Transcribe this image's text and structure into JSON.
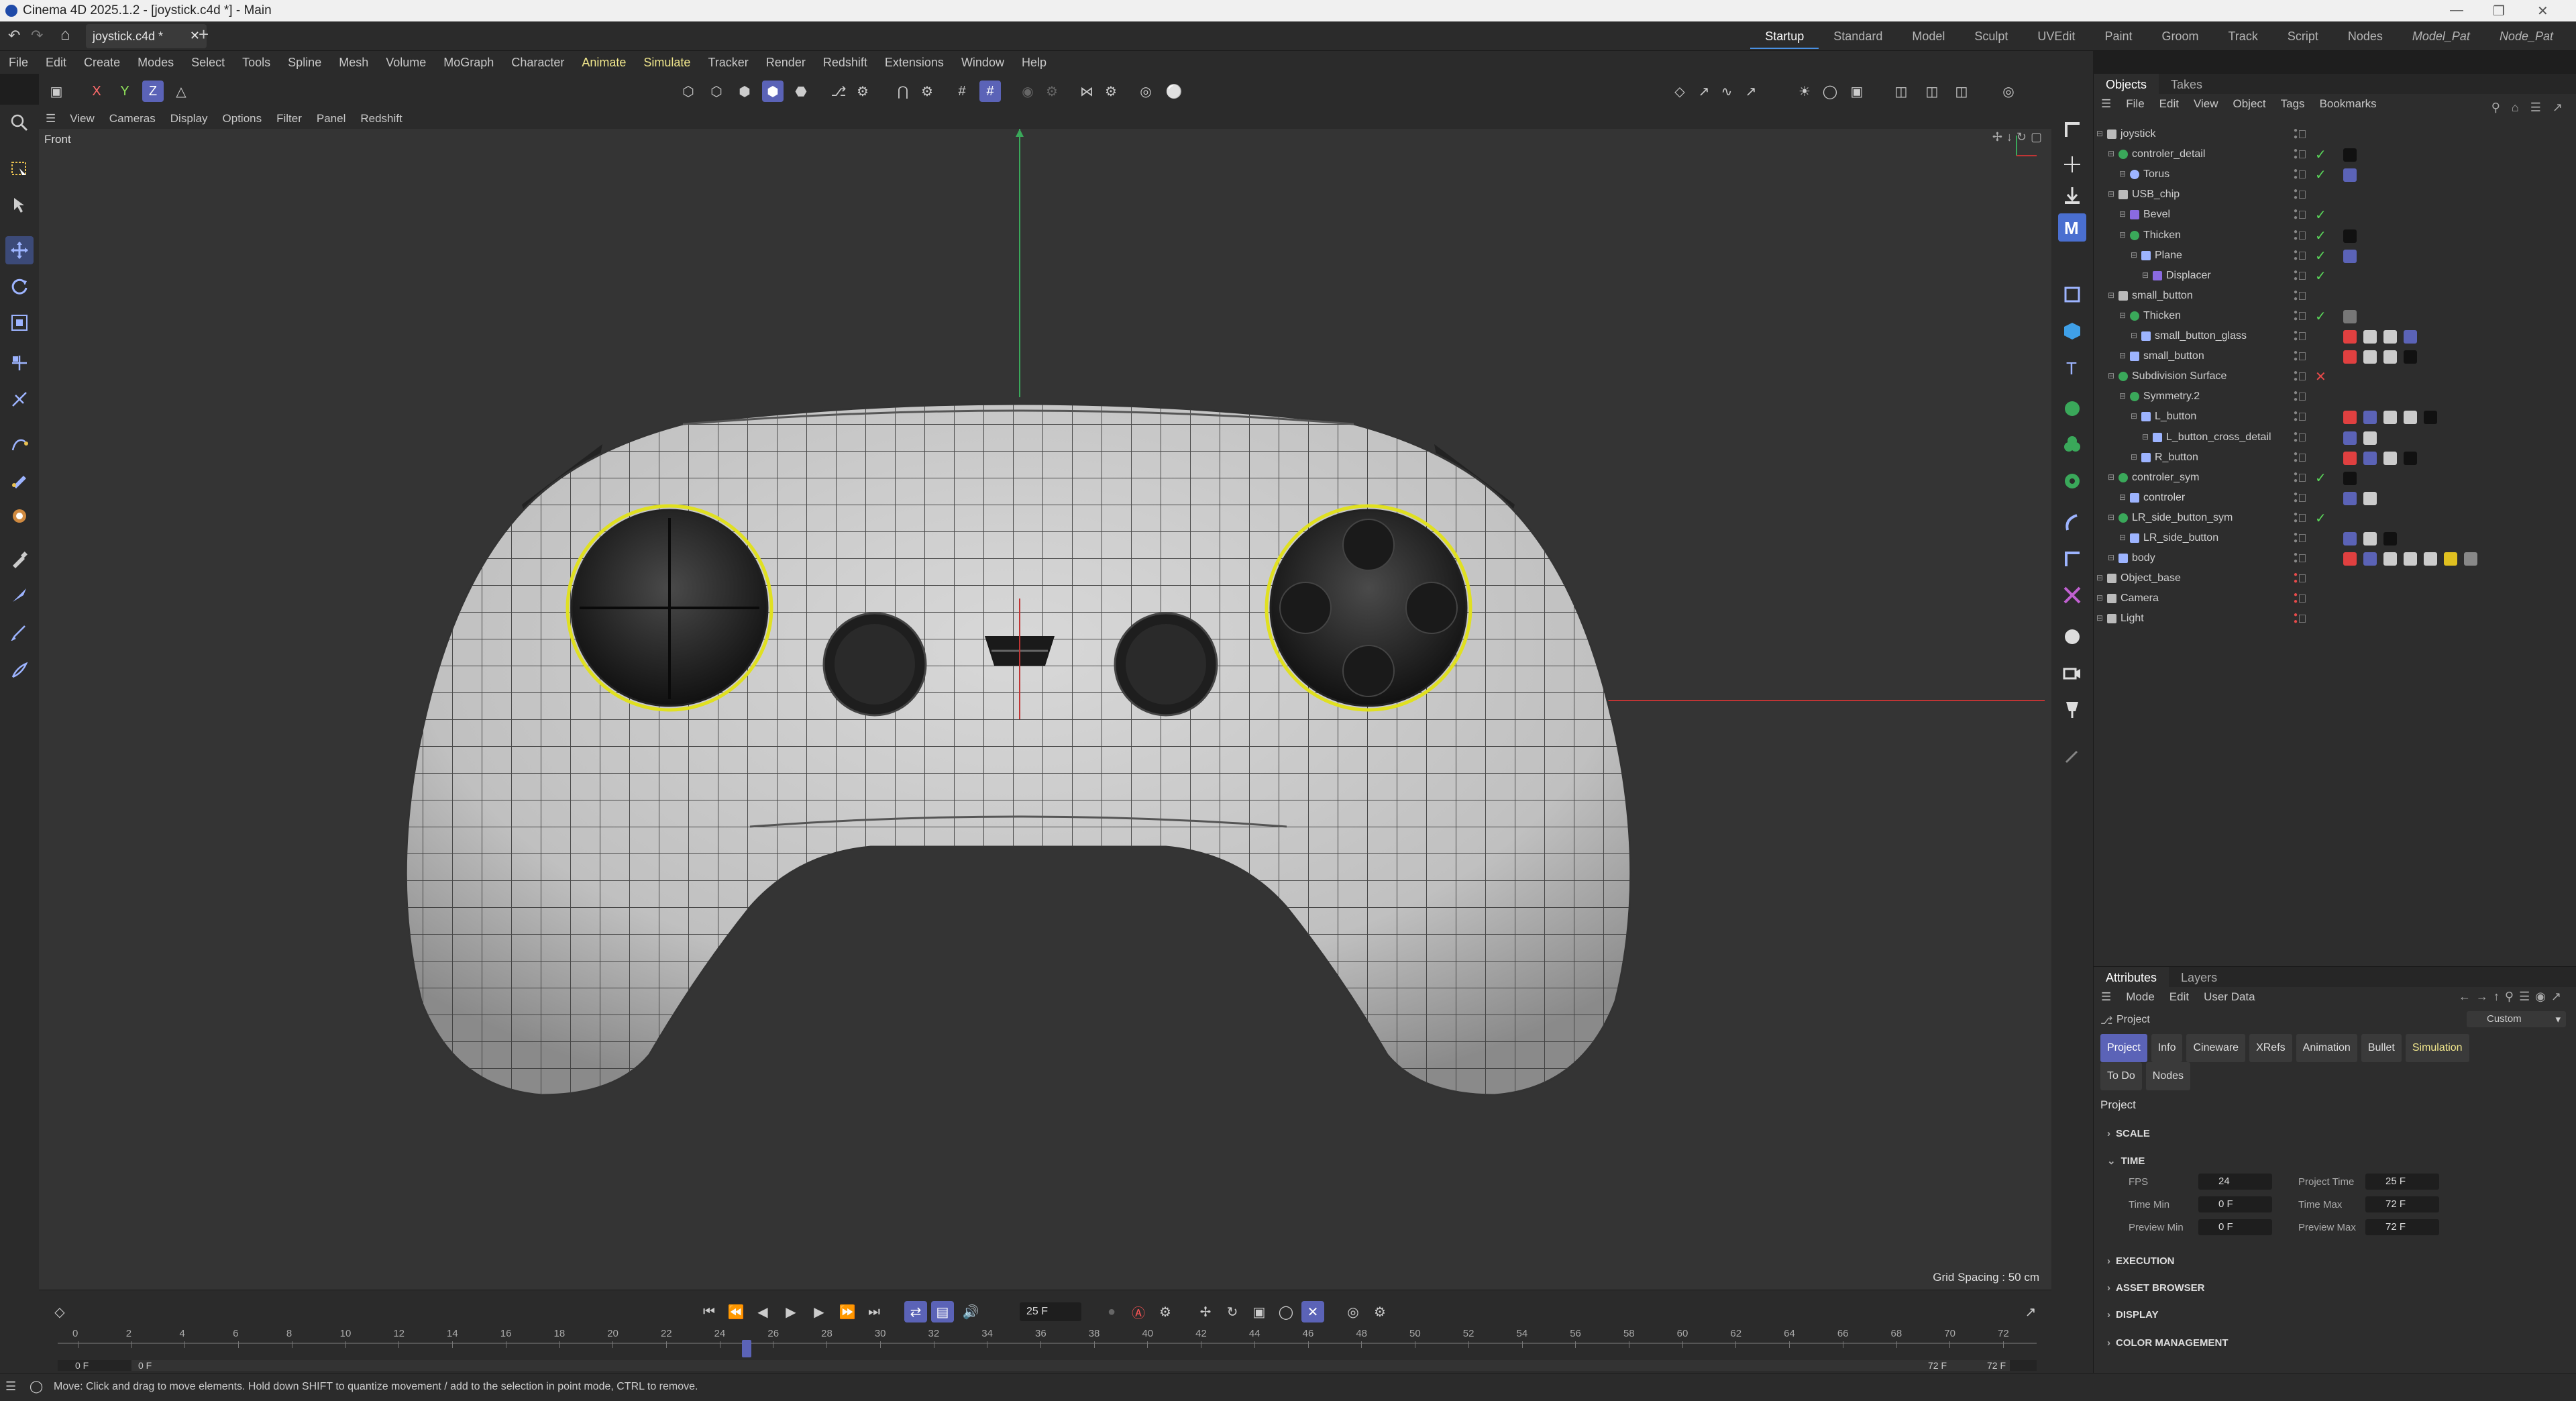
{
  "window": {
    "title": "Cinema 4D 2025.1.2 - [joystick.c4d *] - Main"
  },
  "file_tab": {
    "label": "joystick.c4d *"
  },
  "layouts": [
    "Startup",
    "Standard",
    "Model",
    "Sculpt",
    "UVEdit",
    "Paint",
    "Groom",
    "Track",
    "Script",
    "Nodes",
    "Model_Pat",
    "Node_Pat"
  ],
  "active_layout": "Startup",
  "menu": [
    "File",
    "Edit",
    "Create",
    "Modes",
    "Select",
    "Tools",
    "Spline",
    "Mesh",
    "Volume",
    "MoGraph",
    "Character",
    "Animate",
    "Simulate",
    "Tracker",
    "Render",
    "Redshift",
    "Extensions",
    "Window",
    "Help"
  ],
  "highlighted_menus": [
    "Animate",
    "Simulate"
  ],
  "toolbar": {
    "axis_x": "X",
    "axis_y": "Y",
    "axis_z": "Z"
  },
  "viewport": {
    "menu": [
      "View",
      "Cameras",
      "Display",
      "Options",
      "Filter",
      "Panel",
      "Redshift"
    ],
    "label": "Front",
    "grid_spacing": "Grid Spacing : 50 cm"
  },
  "object_manager": {
    "tabs": [
      "Objects",
      "Takes"
    ],
    "menu": [
      "File",
      "Edit",
      "View",
      "Object",
      "Tags",
      "Bookmarks"
    ],
    "objects": [
      {
        "name": "joystick",
        "depth": 0,
        "icon": "null",
        "check": ""
      },
      {
        "name": "controler_detail",
        "depth": 1,
        "icon": "green",
        "check": "ok"
      },
      {
        "name": "Torus",
        "depth": 2,
        "icon": "torus",
        "check": "ok"
      },
      {
        "name": "USB_chip",
        "depth": 1,
        "icon": "null",
        "check": ""
      },
      {
        "name": "Bevel",
        "depth": 2,
        "icon": "purple",
        "check": "ok"
      },
      {
        "name": "Thicken",
        "depth": 2,
        "icon": "green",
        "check": "ok"
      },
      {
        "name": "Plane",
        "depth": 3,
        "icon": "plane",
        "check": "ok"
      },
      {
        "name": "Displacer",
        "depth": 4,
        "icon": "purple",
        "check": "ok"
      },
      {
        "name": "small_button",
        "depth": 1,
        "icon": "null",
        "check": ""
      },
      {
        "name": "Thicken",
        "depth": 2,
        "icon": "green",
        "check": "ok"
      },
      {
        "name": "small_button_glass",
        "depth": 3,
        "icon": "poly",
        "check": ""
      },
      {
        "name": "small_button",
        "depth": 2,
        "icon": "poly",
        "check": ""
      },
      {
        "name": "Subdivision Surface",
        "depth": 1,
        "icon": "green",
        "check": "x"
      },
      {
        "name": "Symmetry.2",
        "depth": 2,
        "icon": "green",
        "check": ""
      },
      {
        "name": "L_button",
        "depth": 3,
        "icon": "poly",
        "check": ""
      },
      {
        "name": "L_button_cross_detail",
        "depth": 4,
        "icon": "poly",
        "check": ""
      },
      {
        "name": "R_button",
        "depth": 3,
        "icon": "poly",
        "check": ""
      },
      {
        "name": "controler_sym",
        "depth": 1,
        "icon": "green",
        "check": "ok"
      },
      {
        "name": "controler",
        "depth": 2,
        "icon": "poly",
        "check": ""
      },
      {
        "name": "LR_side_button_sym",
        "depth": 1,
        "icon": "green",
        "check": "ok"
      },
      {
        "name": "LR_side_button",
        "depth": 2,
        "icon": "poly",
        "check": ""
      },
      {
        "name": "body",
        "depth": 1,
        "icon": "poly",
        "check": ""
      },
      {
        "name": "Object_base",
        "depth": 0,
        "icon": "null",
        "check": ""
      },
      {
        "name": "Camera",
        "depth": 0,
        "icon": "null",
        "check": ""
      },
      {
        "name": "Light",
        "depth": 0,
        "icon": "null",
        "check": ""
      }
    ]
  },
  "attributes": {
    "tabs": [
      "Attributes",
      "Layers"
    ],
    "menu": [
      "Mode",
      "Edit",
      "User Data"
    ],
    "object_label": "Project",
    "mode_select": "Custom",
    "subtabs": [
      "Project",
      "Info",
      "Cineware",
      "XRefs",
      "Animation",
      "Bullet",
      "Simulation",
      "To Do",
      "Nodes"
    ],
    "section_title": "Project",
    "sections": [
      "SCALE",
      "TIME",
      "EXECUTION",
      "ASSET BROWSER",
      "DISPLAY",
      "COLOR MANAGEMENT"
    ],
    "time_fields": {
      "fps_label": "FPS",
      "fps": "24",
      "project_time_label": "Project Time",
      "project_time": "25 F",
      "time_min_label": "Time Min",
      "time_min": "0 F",
      "time_max_label": "Time Max",
      "time_max": "72 F",
      "preview_min_label": "Preview Min",
      "preview_min": "0 F",
      "preview_max_label": "Preview Max",
      "preview_max": "72 F"
    }
  },
  "timeline": {
    "current_frame": "25 F",
    "ticks": [
      "0",
      "2",
      "4",
      "6",
      "8",
      "10",
      "12",
      "14",
      "16",
      "18",
      "20",
      "22",
      "24",
      "26",
      "28",
      "30",
      "32",
      "34",
      "36",
      "38",
      "40",
      "42",
      "44",
      "46",
      "48",
      "50",
      "52",
      "54",
      "56",
      "58",
      "60",
      "62",
      "64",
      "66",
      "68",
      "70",
      "72"
    ],
    "playhead_label": "25",
    "start_a": "0 F",
    "start_b": "0 F",
    "end_a": "72 F",
    "end_b": "72 F"
  },
  "status": {
    "text": "Move: Click and drag to move elements. Hold down SHIFT to quantize movement / add to the selection in point mode, CTRL to remove."
  }
}
